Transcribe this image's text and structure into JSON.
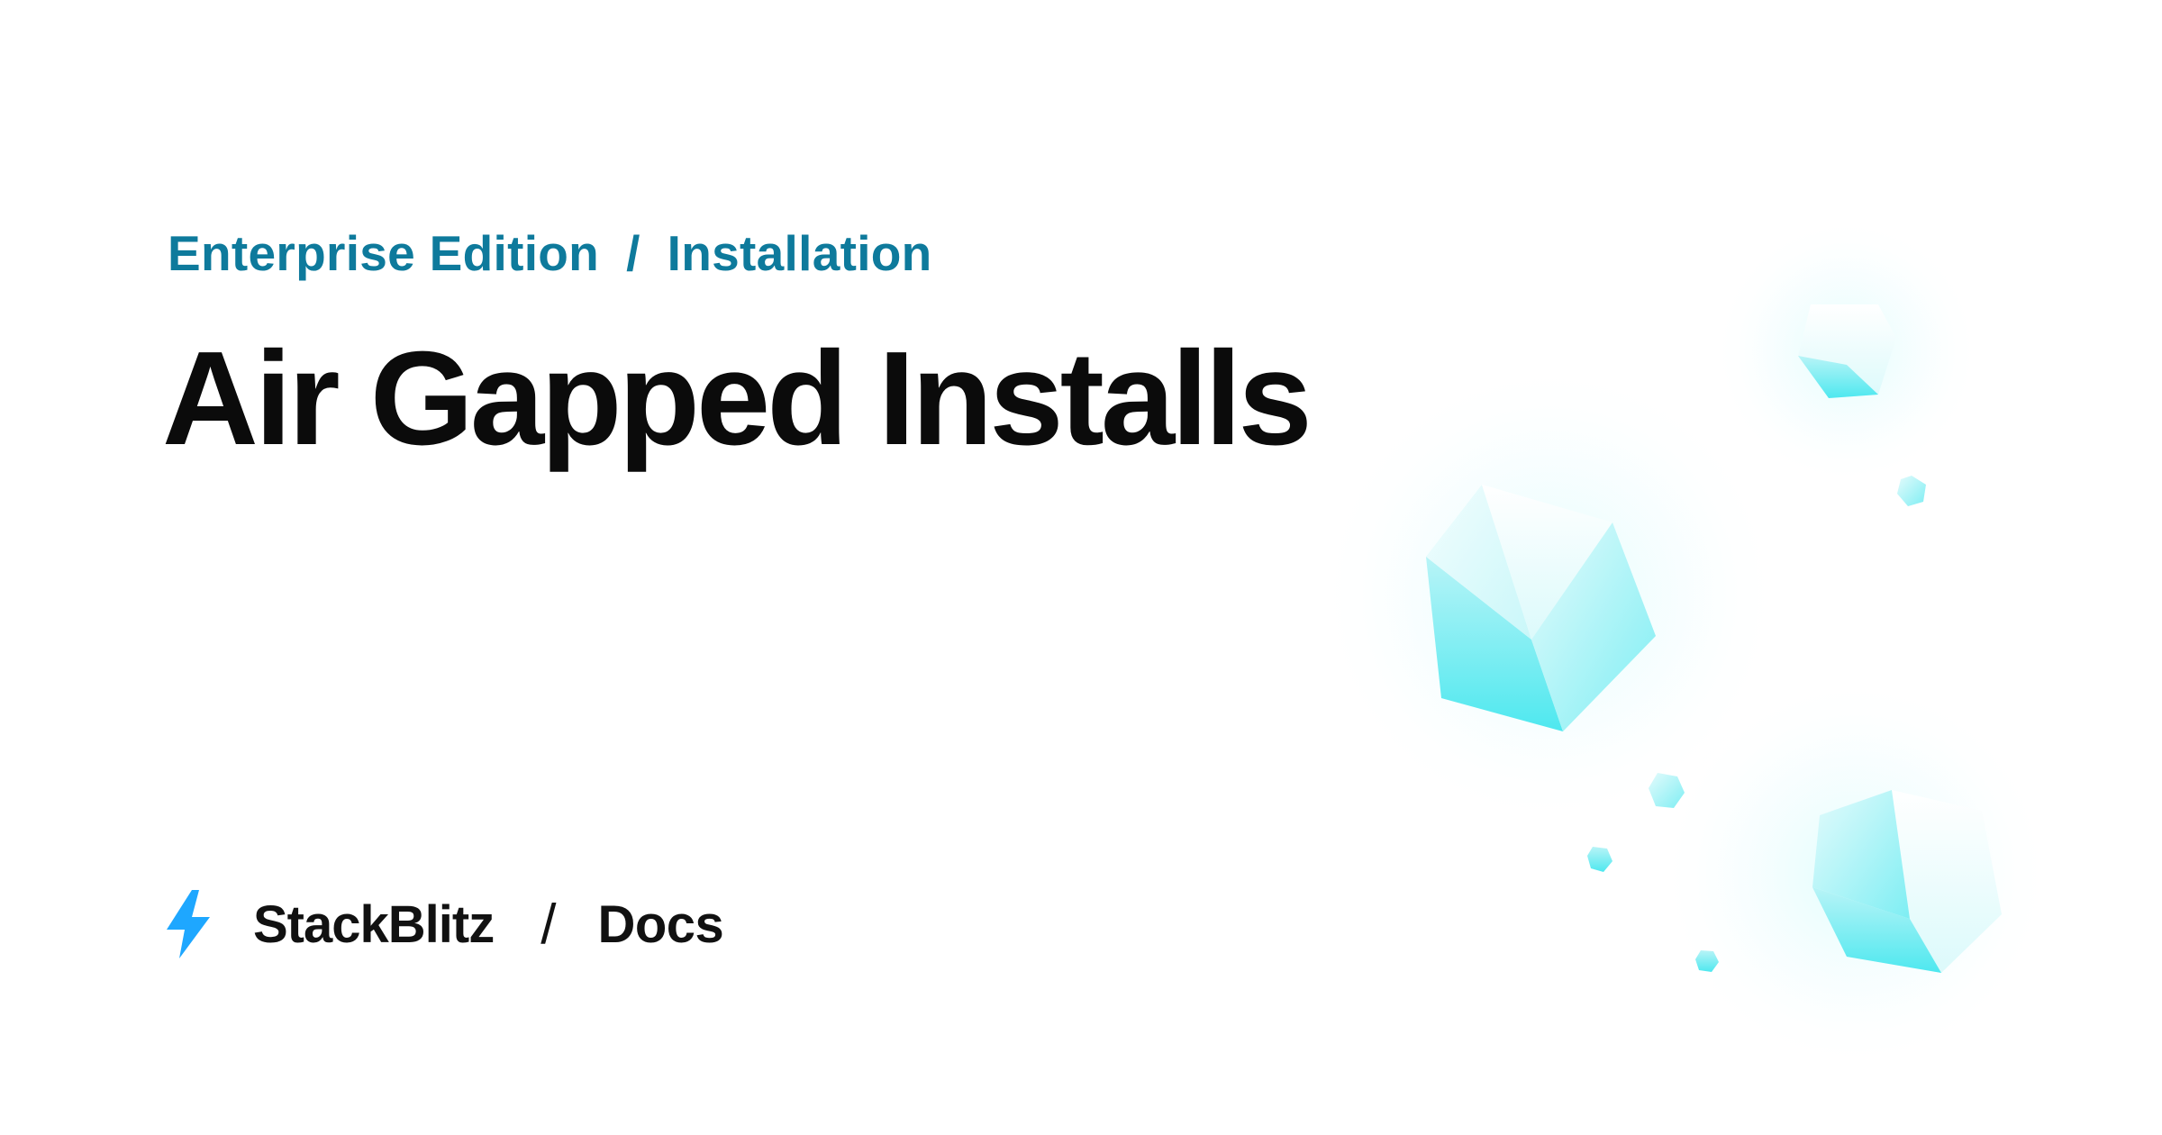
{
  "breadcrumb": {
    "section": "Enterprise Edition",
    "separator": "/",
    "page": "Installation"
  },
  "title": "Air Gapped Installs",
  "footer": {
    "logo_icon": "lightning-bolt-icon",
    "brand": "StackBlitz",
    "separator": "/",
    "section": "Docs"
  },
  "colors": {
    "accent": "#0e7a9c",
    "bolt": "#1ea7ff",
    "crystal": "#5df0f4",
    "text": "#0b0b0b"
  }
}
